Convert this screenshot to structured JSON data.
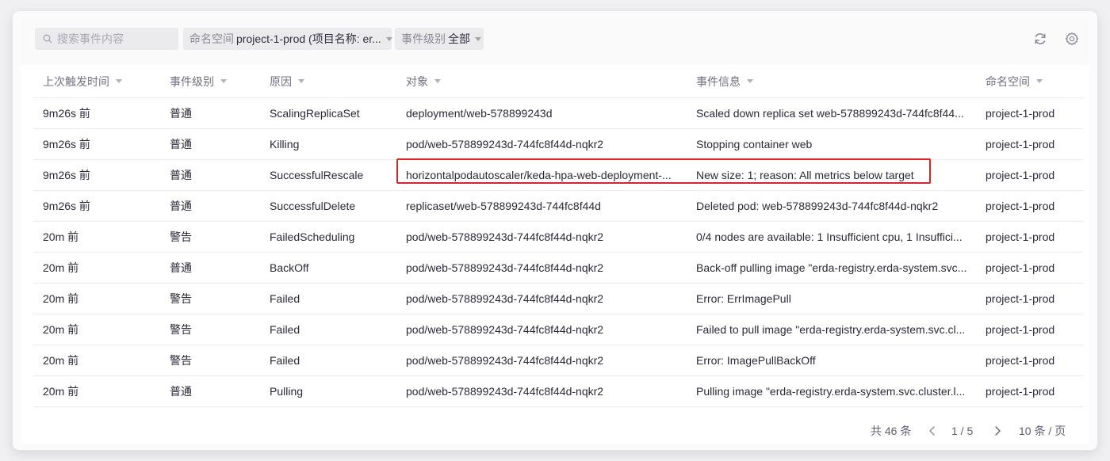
{
  "toolbar": {
    "search_placeholder": "搜索事件内容",
    "namespace_filter": {
      "label": "命名空间",
      "value": "project-1-prod (项目名称: er..."
    },
    "level_filter": {
      "label": "事件级别",
      "value": "全部"
    }
  },
  "table": {
    "columns": [
      "上次触发时间",
      "事件级别",
      "原因",
      "对象",
      "事件信息",
      "命名空间"
    ],
    "rows": [
      [
        "9m26s 前",
        "普通",
        "ScalingReplicaSet",
        "deployment/web-578899243d",
        "Scaled down replica set web-578899243d-744fc8f44...",
        "project-1-prod"
      ],
      [
        "9m26s 前",
        "普通",
        "Killing",
        "pod/web-578899243d-744fc8f44d-nqkr2",
        "Stopping container web",
        "project-1-prod"
      ],
      [
        "9m26s 前",
        "普通",
        "SuccessfulRescale",
        "horizontalpodautoscaler/keda-hpa-web-deployment-...",
        "New size: 1; reason: All metrics below target",
        "project-1-prod"
      ],
      [
        "9m26s 前",
        "普通",
        "SuccessfulDelete",
        "replicaset/web-578899243d-744fc8f44d",
        "Deleted pod: web-578899243d-744fc8f44d-nqkr2",
        "project-1-prod"
      ],
      [
        "20m 前",
        "警告",
        "FailedScheduling",
        "pod/web-578899243d-744fc8f44d-nqkr2",
        "0/4 nodes are available: 1 Insufficient cpu, 1 Insuffici...",
        "project-1-prod"
      ],
      [
        "20m 前",
        "普通",
        "BackOff",
        "pod/web-578899243d-744fc8f44d-nqkr2",
        "Back-off pulling image \"erda-registry.erda-system.svc...",
        "project-1-prod"
      ],
      [
        "20m 前",
        "警告",
        "Failed",
        "pod/web-578899243d-744fc8f44d-nqkr2",
        "Error: ErrImagePull",
        "project-1-prod"
      ],
      [
        "20m 前",
        "警告",
        "Failed",
        "pod/web-578899243d-744fc8f44d-nqkr2",
        "Failed to pull image \"erda-registry.erda-system.svc.cl...",
        "project-1-prod"
      ],
      [
        "20m 前",
        "警告",
        "Failed",
        "pod/web-578899243d-744fc8f44d-nqkr2",
        "Error: ImagePullBackOff",
        "project-1-prod"
      ],
      [
        "20m 前",
        "普通",
        "Pulling",
        "pod/web-578899243d-744fc8f44d-nqkr2",
        "Pulling image \"erda-registry.erda-system.svc.cluster.l...",
        "project-1-prod"
      ]
    ]
  },
  "pagination": {
    "total": "共 46 条",
    "page": "1 / 5",
    "page_size": "10 条 / 页"
  },
  "icons": {
    "refresh": "refresh-icon",
    "settings": "gear-icon",
    "search": "search-icon"
  },
  "colors": {
    "highlight_border": "#d9252a"
  }
}
